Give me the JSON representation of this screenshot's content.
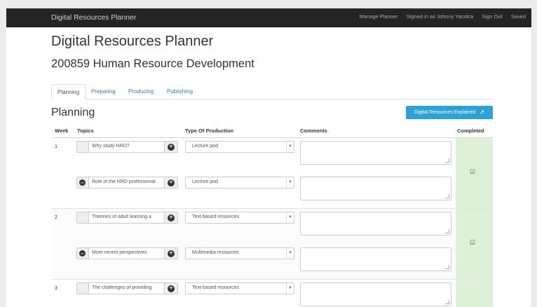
{
  "navbar": {
    "brand": "Digital Resources Planner",
    "manage": "Manage Planner",
    "signed_in": "Signed in as Johnny Yacolca",
    "sign_out": "Sign Out",
    "status": "Saved"
  },
  "page": {
    "title": "Digital Resources Planner",
    "course": "200859 Human Resource Development"
  },
  "tabs": [
    "Planning",
    "Preparing",
    "Producing",
    "Publishing"
  ],
  "section": {
    "title": "Planning",
    "explain_button": "Digital Resources Explained"
  },
  "table": {
    "headers": {
      "week": "Week",
      "topics": "Topics",
      "type": "Type Of Production",
      "comments": "Comments",
      "completed": "Completed"
    },
    "weeks": [
      {
        "number": "1",
        "completed": true,
        "rows": [
          {
            "topic": "Why study HRD?",
            "type": "Lecture pod",
            "comment": ""
          },
          {
            "topic": "Role of the HRD professional",
            "type": "Lecture pod",
            "comment": ""
          }
        ]
      },
      {
        "number": "2",
        "completed": true,
        "rows": [
          {
            "topic": "Theories of adult learning a",
            "type": "Text-based resources",
            "comment": ""
          },
          {
            "topic": "More recent perspectives",
            "type": "Multimedia resources",
            "comment": ""
          }
        ]
      },
      {
        "number": "3",
        "completed": false,
        "rows": [
          {
            "topic": "The challenges of providing",
            "type": "Text-based resources",
            "comment": ""
          }
        ]
      }
    ]
  },
  "icons": {
    "plus": "plus-circle-icon",
    "minus": "minus-circle-icon",
    "external": "external-link-icon",
    "checkbox": "checkbox-checked-icon",
    "caret": "chevron-down-icon"
  },
  "colors": {
    "navbar": "#242424",
    "accent_button": "#2ea2d6",
    "completed_bg": "#dff0d8",
    "link": "#337ab7"
  }
}
